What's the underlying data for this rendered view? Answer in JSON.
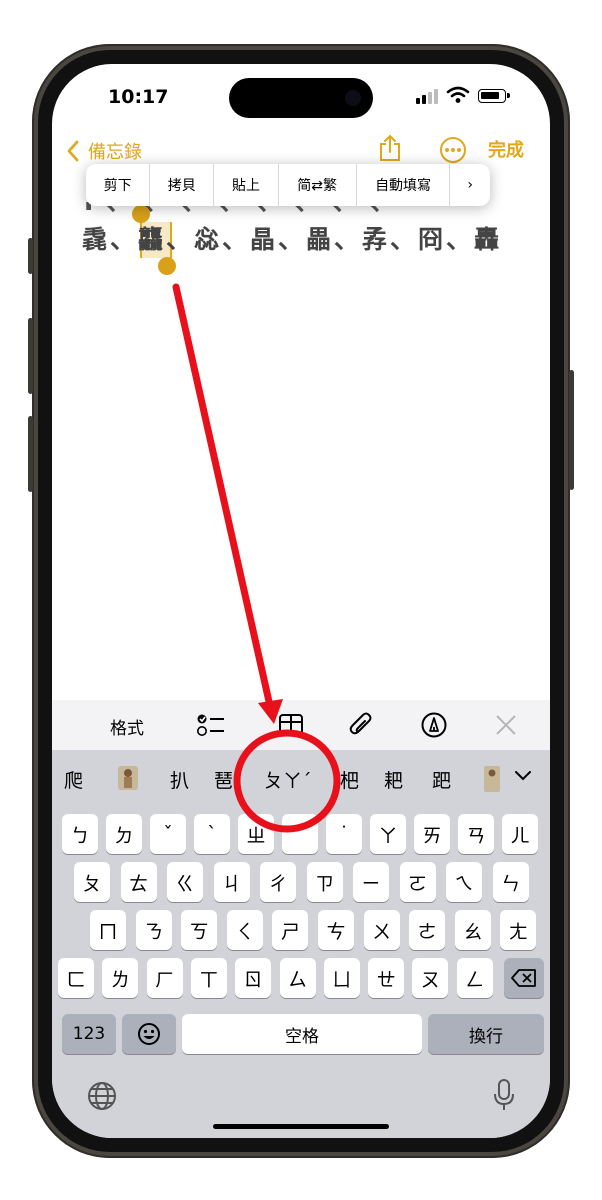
{
  "status_bar": {
    "time": "10:17"
  },
  "nav": {
    "back_label": "備忘錄",
    "done_label": "完成"
  },
  "context_menu": {
    "items": [
      "剪下",
      "拷貝",
      "貼上",
      "简⇄繁",
      "自動填寫",
      "›"
    ]
  },
  "note": {
    "line1": "Ⅰ 、 、 、 、 、 、 、 、",
    "line2": "毳、龘",
    "line2_after": "、惢、晶、畾、孨、冏、轟"
  },
  "toolbar": {
    "format_label": "格式"
  },
  "keyboard": {
    "candidates": [
      "爬",
      "扒",
      "琶",
      "ㄆㄚˊ",
      "杷",
      "耙",
      "跁"
    ],
    "row1": [
      "ㄅ",
      "ㄉ",
      "ˇ",
      "ˋ",
      "ㄓ",
      "ˊ",
      "˙",
      "ㄚ",
      "ㄞ",
      "ㄢ",
      "ㄦ"
    ],
    "row2": [
      "ㄆ",
      "ㄊ",
      "ㄍ",
      "ㄐ",
      "ㄔ",
      "ㄗ",
      "ㄧ",
      "ㄛ",
      "ㄟ",
      "ㄣ"
    ],
    "row3": [
      "ㄇ",
      "ㄋ",
      "ㄎ",
      "ㄑ",
      "ㄕ",
      "ㄘ",
      "ㄨ",
      "ㄜ",
      "ㄠ",
      "ㄤ"
    ],
    "row4": [
      "ㄈ",
      "ㄌ",
      "ㄏ",
      "ㄒ",
      "ㄖ",
      "ㄙ",
      "ㄩ",
      "ㄝ",
      "ㄡ",
      "ㄥ"
    ],
    "numbers_label": "123",
    "space_label": "空格",
    "return_label": "換行"
  },
  "annotation": {
    "color": "#e8101a"
  },
  "accent_color": "#e1a81c"
}
